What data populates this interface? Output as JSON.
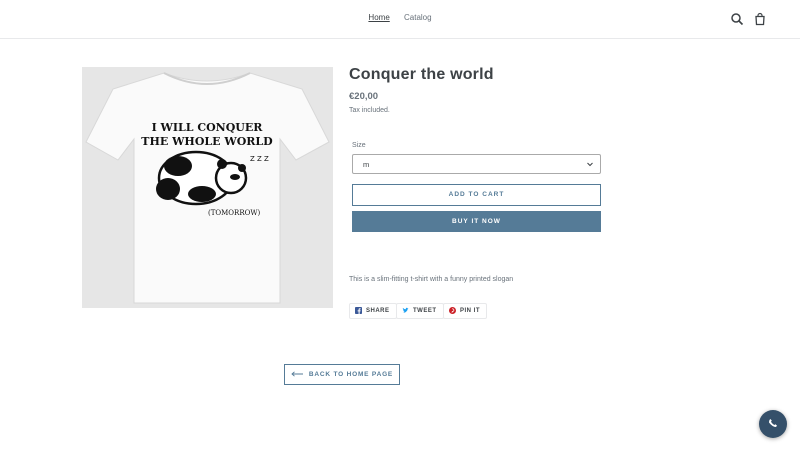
{
  "header": {
    "nav": [
      {
        "label": "Home",
        "active": true
      },
      {
        "label": "Catalog",
        "active": false
      }
    ],
    "icons": [
      "search-icon",
      "cart-icon"
    ]
  },
  "product": {
    "title": "Conquer the world",
    "price": "€20,00",
    "tax_note": "Tax included.",
    "image": {
      "print_line1": "I WILL CONQUER",
      "print_line2": "THE WHOLE WORLD",
      "print_line3": "(TOMORROW)",
      "print_zzz": "Z Z Z"
    },
    "size_label": "Size",
    "size_value": "m",
    "add_to_cart_label": "ADD TO CART",
    "buy_now_label": "BUY IT NOW",
    "description": "This is a slim-fitting t-shirt with a funny printed slogan"
  },
  "social": {
    "share_label": "SHARE",
    "tweet_label": "TWEET",
    "pin_label": "PIN IT"
  },
  "back_label": "BACK TO HOME PAGE",
  "colors": {
    "accent": "#557b97",
    "text": "#3d4246",
    "muted": "#69727b",
    "chat": "#35506a"
  }
}
